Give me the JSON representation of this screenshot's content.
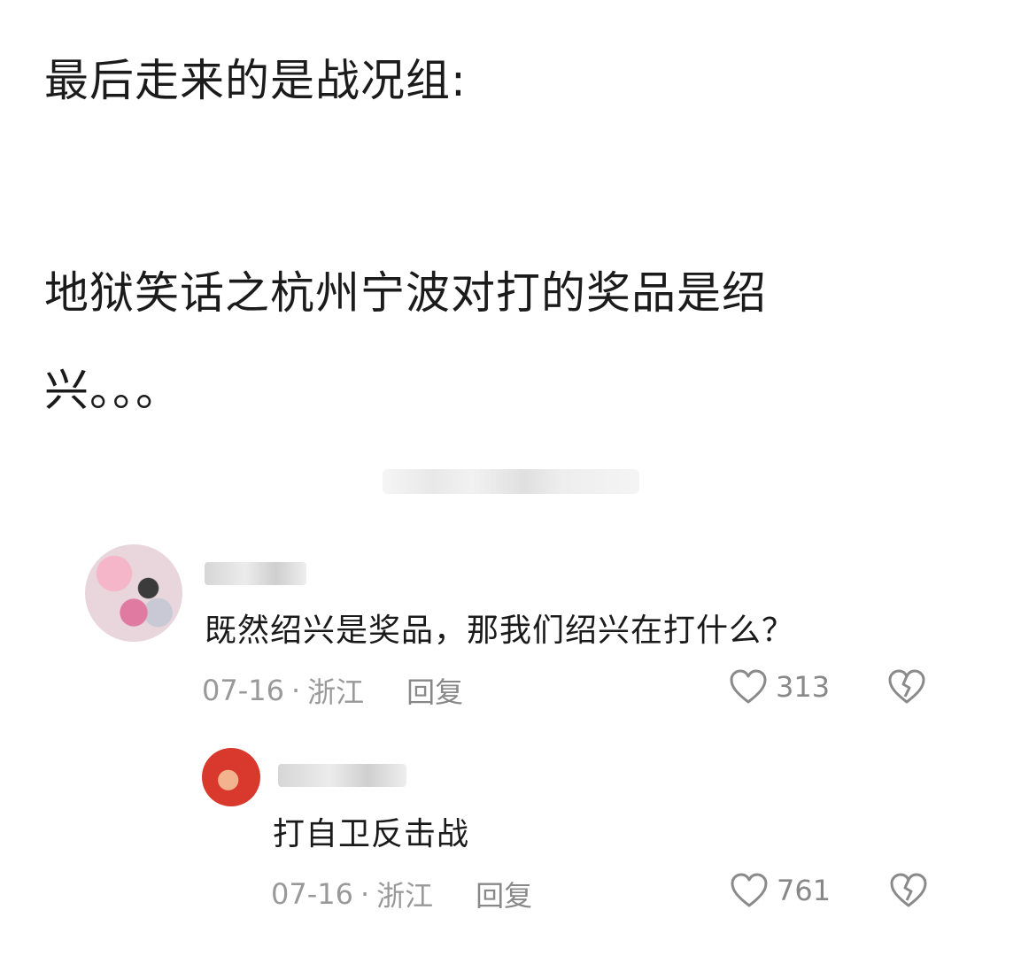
{
  "post": {
    "line1": "最后走来的是战况组:",
    "line2a": "地狱笑话之杭州宁波对打的奖品是绍",
    "line2b": "兴。。。"
  },
  "comments": [
    {
      "text": "既然绍兴是奖品，那我们绍兴在打什么？",
      "date": "07-16",
      "dot": "·",
      "location": "浙江",
      "reply_label": "回复",
      "likes": "313"
    },
    {
      "text": "打自卫反击战",
      "date": "07-16",
      "dot": "·",
      "location": "浙江",
      "reply_label": "回复",
      "likes": "761"
    }
  ],
  "icons": {
    "like": "heart-outline-icon",
    "dislike": "broken-heart-icon"
  }
}
